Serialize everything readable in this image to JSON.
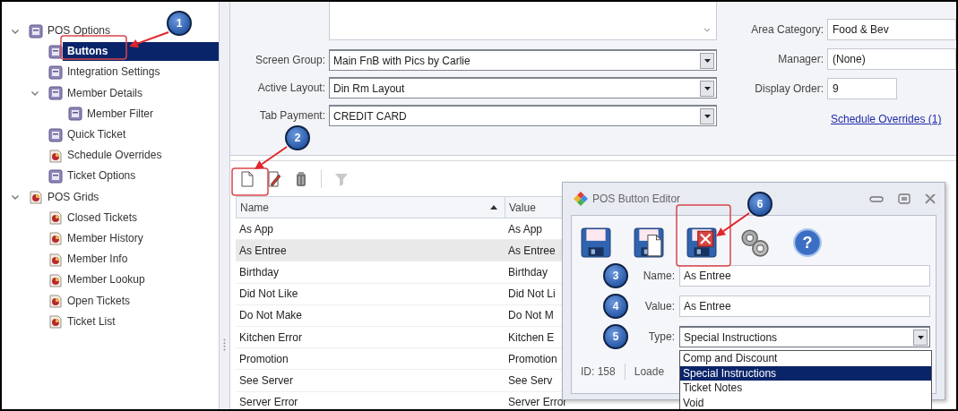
{
  "sidebar": {
    "tree": [
      {
        "label": "POS Options",
        "kind": "form",
        "expanded": true,
        "selected": false,
        "children": [
          {
            "label": "Buttons",
            "kind": "form",
            "selected": true
          },
          {
            "label": "Integration Settings",
            "kind": "form",
            "selected": false
          },
          {
            "label": "Member Details",
            "kind": "form",
            "expanded": true,
            "selected": false,
            "children": [
              {
                "label": "Member Filter",
                "kind": "form",
                "selected": false
              }
            ]
          },
          {
            "label": "Quick Ticket",
            "kind": "form",
            "selected": false
          },
          {
            "label": "Schedule Overrides",
            "kind": "grid",
            "selected": false
          },
          {
            "label": "Ticket Options",
            "kind": "form",
            "selected": false
          }
        ]
      },
      {
        "label": "POS Grids",
        "kind": "grid",
        "expanded": true,
        "selected": false,
        "children": [
          {
            "label": "Closed Tickets",
            "kind": "grid",
            "selected": false
          },
          {
            "label": "Member History",
            "kind": "grid",
            "selected": false
          },
          {
            "label": "Member Info",
            "kind": "grid",
            "selected": false
          },
          {
            "label": "Member Lookup",
            "kind": "grid",
            "selected": false
          },
          {
            "label": "Open Tickets",
            "kind": "grid",
            "selected": false
          },
          {
            "label": "Ticket List",
            "kind": "grid",
            "selected": false
          }
        ]
      }
    ]
  },
  "form": {
    "left": [
      {
        "label": "Screen Group:",
        "value": "Main FnB with Pics by Carlie"
      },
      {
        "label": "Active Layout:",
        "value": "Din Rm Layout"
      },
      {
        "label": "Tab Payment:",
        "value": "CREDIT CARD"
      }
    ],
    "right": [
      {
        "label": "Area Category:",
        "value": "Food & Bev",
        "kind": "wide"
      },
      {
        "label": "Manager:",
        "value": "(None)",
        "kind": "wide"
      },
      {
        "label": "Display Order:",
        "value": "9",
        "kind": "short"
      }
    ],
    "link": "Schedule Overrides (1)"
  },
  "toolbar": [
    {
      "kind": "new",
      "disabled": false
    },
    {
      "kind": "edit",
      "disabled": false
    },
    {
      "kind": "delete",
      "disabled": false
    },
    {
      "kind": "filter",
      "disabled": true
    }
  ],
  "grid": {
    "columns": [
      {
        "label": "Name",
        "sorted": true
      },
      {
        "label": "Value"
      }
    ],
    "rows": [
      {
        "cells": [
          "As App",
          "As App"
        ],
        "selected": false
      },
      {
        "cells": [
          "As Entree",
          "As Entree"
        ],
        "selected": true
      },
      {
        "cells": [
          "Birthday",
          "Birthday"
        ],
        "selected": false
      },
      {
        "cells": [
          "Did Not Like",
          "Did Not Li"
        ],
        "selected": false
      },
      {
        "cells": [
          "Do Not Make",
          "Do Not M"
        ],
        "selected": false
      },
      {
        "cells": [
          "Kitchen Error",
          "Kitchen E"
        ],
        "selected": false
      },
      {
        "cells": [
          "Promotion",
          "Promotion"
        ],
        "selected": false
      },
      {
        "cells": [
          "See Server",
          "See Serv"
        ],
        "selected": false
      },
      {
        "cells": [
          "Server Error",
          "Server Error"
        ],
        "selected": false
      }
    ]
  },
  "dialog": {
    "title": "POS Button Editor",
    "tools": [
      {
        "kind": "save"
      },
      {
        "kind": "save-new"
      },
      {
        "kind": "save-delete"
      },
      {
        "kind": "options"
      },
      {
        "kind": "help",
        "glyph": "?"
      }
    ],
    "fields": [
      {
        "callout": "3",
        "label": "Name:",
        "value": "As Entree",
        "kind": "text"
      },
      {
        "callout": "4",
        "label": "Value:",
        "value": "As Entree",
        "kind": "text"
      },
      {
        "callout": "5",
        "label": "Type:",
        "value": "Special Instructions",
        "kind": "combo",
        "open": true,
        "options": [
          {
            "label": "Comp and Discount",
            "selected": false
          },
          {
            "label": "Special Instructions",
            "selected": true
          },
          {
            "label": "Ticket Notes",
            "selected": false
          },
          {
            "label": "Void",
            "selected": false
          }
        ]
      }
    ],
    "status": [
      "ID: 158",
      "Loade"
    ]
  },
  "annotations": [
    {
      "number": "1"
    },
    {
      "number": "2"
    },
    {
      "number": "6"
    }
  ]
}
